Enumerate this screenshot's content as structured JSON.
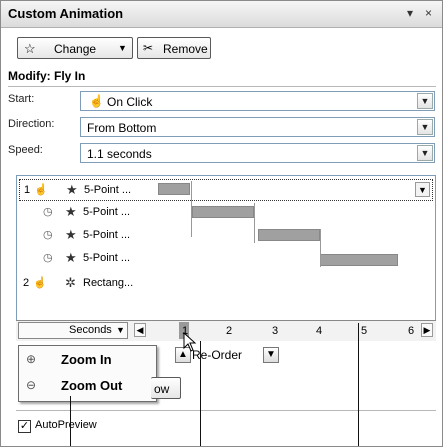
{
  "panel": {
    "title": "Custom Animation",
    "dropdown_glyph": "▾",
    "close_glyph": "×"
  },
  "toolbar": {
    "change_label": "Change",
    "remove_label": "Remove"
  },
  "modify": {
    "heading": "Modify: Fly In",
    "start": {
      "label": "Start:",
      "value": "On Click"
    },
    "direction": {
      "label": "Direction:",
      "value": "From Bottom"
    },
    "speed": {
      "label": "Speed:",
      "value": "1.1 seconds"
    }
  },
  "animation_list": [
    {
      "number": "1",
      "trigger_icon": "mouse-click-icon",
      "effect_icon": "star-effect-icon",
      "name": "5-Point ...",
      "selected": true
    },
    {
      "number": "",
      "trigger_icon": "clock-icon",
      "effect_icon": "star-effect-icon",
      "name": "5-Point ...",
      "selected": false
    },
    {
      "number": "",
      "trigger_icon": "clock-icon",
      "effect_icon": "star-effect-icon",
      "name": "5-Point ...",
      "selected": false
    },
    {
      "number": "",
      "trigger_icon": "clock-icon",
      "effect_icon": "star-effect-icon",
      "name": "5-Point ...",
      "selected": false
    },
    {
      "number": "2",
      "trigger_icon": "mouse-click-icon",
      "effect_icon": "shape-effect-icon",
      "name": "Rectang...",
      "selected": false
    }
  ],
  "timeline": {
    "seconds_label": "Seconds",
    "ticks": [
      "1",
      "2",
      "3",
      "4",
      "5",
      "6"
    ]
  },
  "zoom_menu": {
    "zoom_in": "Zoom In",
    "zoom_out": "Zoom Out"
  },
  "reorder": {
    "label": "Re-Order",
    "partial_button_label": "ow"
  },
  "autopreview": {
    "label": "AutoPreview",
    "checked": true
  }
}
